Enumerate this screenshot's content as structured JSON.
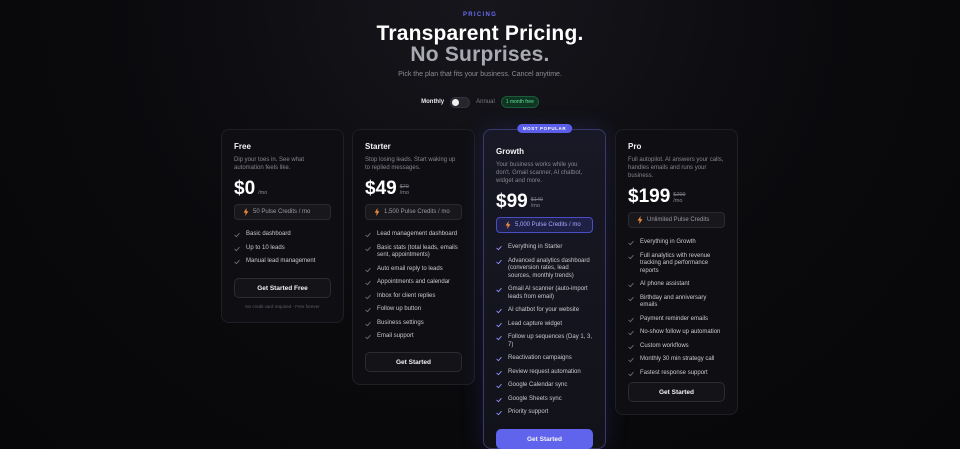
{
  "header": {
    "eyebrow": "PRICING",
    "title_line1": "Transparent Pricing.",
    "title_line2": "No Surprises.",
    "subtitle": "Pick the plan that fits your business. Cancel anytime."
  },
  "billing": {
    "monthly_label": "Monthly",
    "annual_label": "Annual",
    "annual_badge": "1 month free",
    "selected": "Monthly"
  },
  "colors": {
    "accent": "#6063ec",
    "eyebrow": "#6a6df5",
    "badge_green": "#5fe29a",
    "bolt": "#f08c3a"
  },
  "plans": [
    {
      "name": "Free",
      "description": "Dip your toes in. See what automation feels like.",
      "price": "$0",
      "old_price": "",
      "period": "/mo",
      "credits": "50 Pulse Credits / mo",
      "features": [
        "Basic dashboard",
        "Up to 10 leads",
        "Manual lead management"
      ],
      "cta": "Get Started Free",
      "fineprint": "No credit card required · Free forever"
    },
    {
      "name": "Starter",
      "description": "Stop losing leads. Start waking up to replied messages.",
      "price": "$49",
      "old_price": "$79",
      "period": "/mo",
      "credits": "1,500 Pulse Credits / mo",
      "features": [
        "Lead management dashboard",
        "Basic stats (total leads, emails sent, appointments)",
        "Auto email reply to leads",
        "Appointments and calendar",
        "Inbox for client replies",
        "Follow up button",
        "Business settings",
        "Email support"
      ],
      "cta": "Get Started"
    },
    {
      "name": "Growth",
      "badge": "MOST POPULAR",
      "description": "Your business works while you don't. Gmail scanner, AI chatbot, widget and more.",
      "price": "$99",
      "old_price": "$149",
      "period": "/mo",
      "credits": "5,000 Pulse Credits / mo",
      "features": [
        "Everything in Starter",
        "Advanced analytics dashboard (conversion rates, lead sources, monthly trends)",
        "Gmail AI scanner (auto-import leads from email)",
        "AI chatbot for your website",
        "Lead capture widget",
        "Follow up sequences (Day 1, 3, 7)",
        "Reactivation campaigns",
        "Review request automation",
        "Google Calendar sync",
        "Google Sheets sync",
        "Priority support"
      ],
      "cta": "Get Started"
    },
    {
      "name": "Pro",
      "description": "Full autopilot. AI answers your calls, handles emails and runs your business.",
      "price": "$199",
      "old_price": "$299",
      "period": "/mo",
      "credits": "Unlimited Pulse Credits",
      "features": [
        "Everything in Growth",
        "Full analytics with revenue tracking and performance reports",
        "AI phone assistant",
        "Birthday and anniversary emails",
        "Payment reminder emails",
        "No-show follow up automation",
        "Custom workflows",
        "Monthly 30 min strategy call",
        "Fastest response support"
      ],
      "cta": "Get Started"
    }
  ]
}
